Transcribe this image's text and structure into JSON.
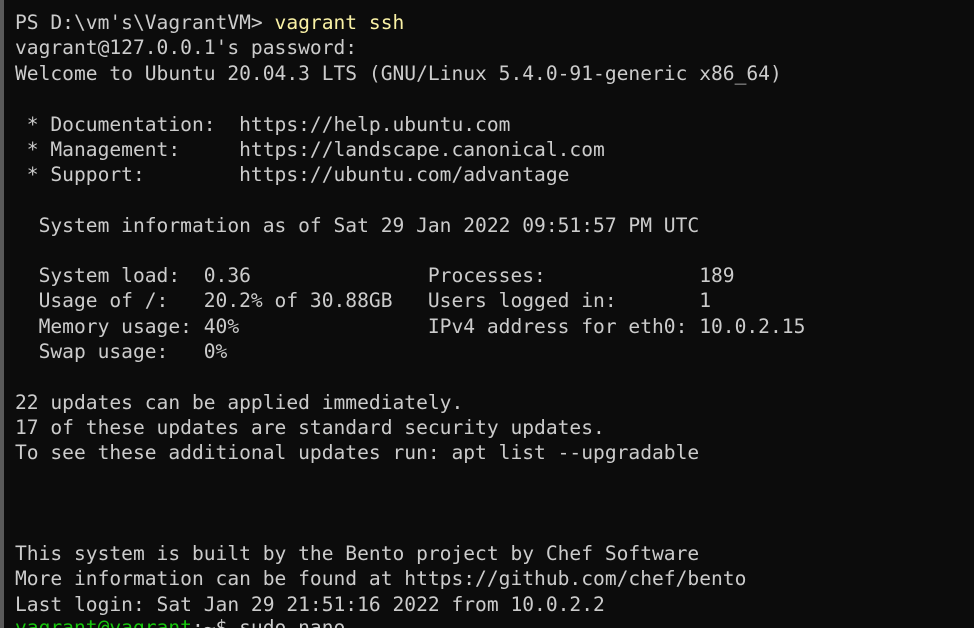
{
  "colors": {
    "background": "#0c0c0c",
    "text": "#cccccc",
    "command": "#f9f1a5",
    "prompt_user": "#16c60c"
  },
  "terminal": {
    "prompt": "PS D:\\vm's\\VagrantVM> ",
    "command": "vagrant ssh",
    "password_prompt": "vagrant@127.0.0.1's password:",
    "welcome": "Welcome to Ubuntu 20.04.3 LTS (GNU/Linux 5.4.0-91-generic x86_64)",
    "links": [
      " * Documentation:  https://help.ubuntu.com",
      " * Management:     https://landscape.canonical.com",
      " * Support:        https://ubuntu.com/advantage"
    ],
    "sysinfo_header": "  System information as of Sat 29 Jan 2022 09:51:57 PM UTC",
    "stats": [
      "  System load:  0.36               Processes:             189",
      "  Usage of /:   20.2% of 30.88GB   Users logged in:       1",
      "  Memory usage: 40%                IPv4 address for eth0: 10.0.2.15",
      "  Swap usage:   0%"
    ],
    "updates": [
      "22 updates can be applied immediately.",
      "17 of these updates are standard security updates.",
      "To see these additional updates run: apt list --upgradable"
    ],
    "footer": [
      "This system is built by the Bento project by Chef Software",
      "More information can be found at https://github.com/chef/bento",
      "Last login: Sat Jan 29 21:51:16 2022 from 10.0.2.2"
    ],
    "next_prompt_user": "vagrant@vagrant",
    "next_prompt_rest": ":~$ sudo nano"
  }
}
